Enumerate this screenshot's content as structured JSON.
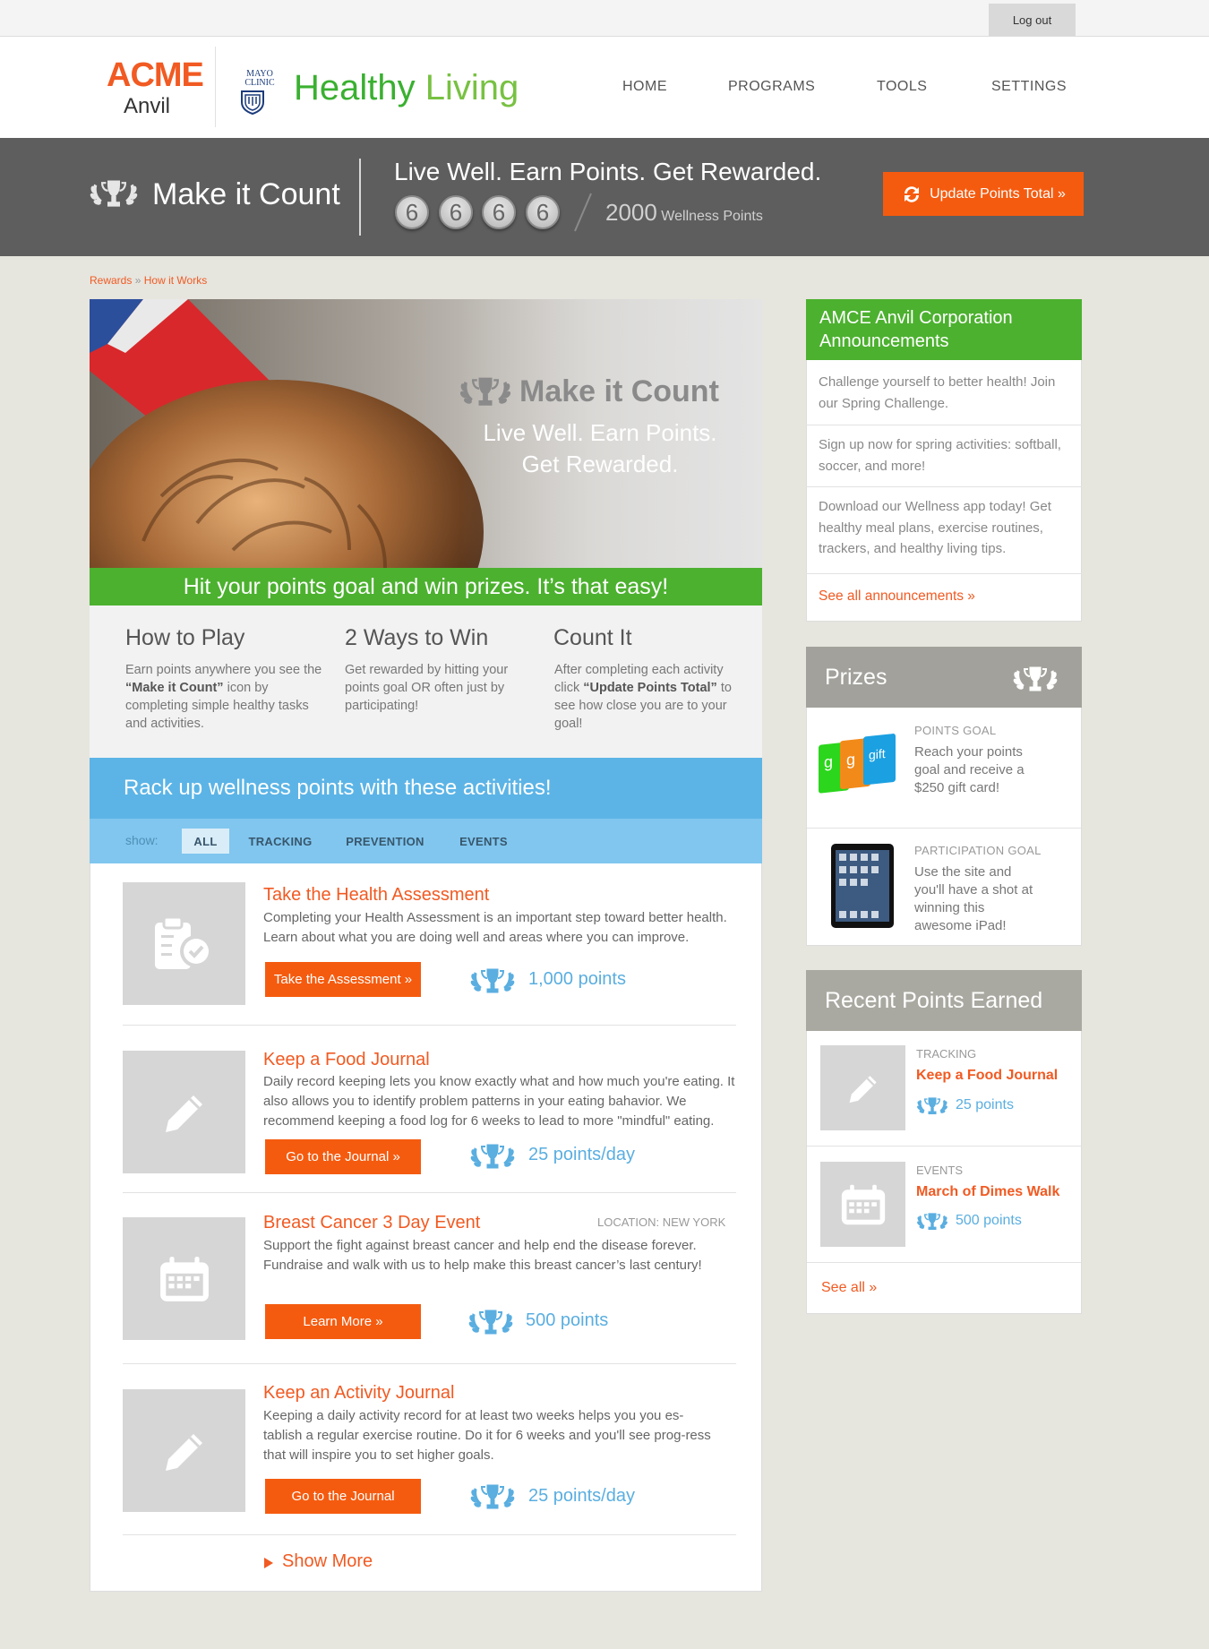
{
  "topbar": {
    "logout_label": "Log out"
  },
  "header": {
    "brand_top": "ACME",
    "brand_bottom": "Anvil",
    "partner_line1": "MAYO",
    "partner_line2": "CLINIC",
    "product_word1": "Healthy",
    "product_word2": "Living",
    "nav": [
      "HOME",
      "PROGRAMS",
      "TOOLS",
      "SETTINGS"
    ]
  },
  "band": {
    "title": "Make it Count",
    "tagline": "Live Well. Earn Points. Get Rewarded.",
    "digits": [
      "6",
      "6",
      "6",
      "6"
    ],
    "goal_value": "2000",
    "goal_label": "Wellness Points",
    "update_button": "Update Points Total »"
  },
  "breadcrumb": {
    "item1": "Rewards",
    "separator": "»",
    "item2": "How it Works"
  },
  "hero": {
    "title": "Make it Count",
    "tagline_line1": "Live Well. Earn Points.",
    "tagline_line2": "Get Rewarded.",
    "green_bar": "Hit your points goal and win prizes. It’s that easy!"
  },
  "howto": [
    {
      "title": "How to Play",
      "text_before": "Earn points anywhere you see the ",
      "bold": "“Make it Count”",
      "text_after": " icon by completing simple healthy tasks and activities."
    },
    {
      "title": "2 Ways to Win",
      "text_before": "Get rewarded by hitting your points goal OR often just by participating!",
      "bold": "",
      "text_after": ""
    },
    {
      "title": "Count It",
      "text_before": "After completing each activity click ",
      "bold": "“Update Points Total”",
      "text_after": " to see how close you are to your goal!"
    }
  ],
  "activities_header": "Rack up wellness points with these activities!",
  "filter": {
    "show_label": "show:",
    "options": [
      "ALL",
      "TRACKING",
      "PREVENTION",
      "EVENTS"
    ],
    "selected": "ALL"
  },
  "activities": [
    {
      "icon": "clipboard-check-icon",
      "title": "Take the Health Assessment",
      "location": "",
      "description": "Completing your Health Assessment is an important step toward better health. Learn about what you are doing well and areas where you can improve.",
      "button": "Take the Assessment »",
      "points": "1,000 points"
    },
    {
      "icon": "pencil-icon",
      "title": "Keep a Food Journal",
      "location": "",
      "description": "Daily record keeping lets you know exactly what and how much you're eating. It also allows you to identify problem patterns in your eating bahavior.  We recommend keeping a food log for 6 weeks to lead to more \"mindful\" eating.",
      "button": "Go to the Journal »",
      "points": "25 points/day"
    },
    {
      "icon": "calendar-icon",
      "title": "Breast Cancer 3 Day Event",
      "location": "LOCATION: NEW YORK",
      "description": "Support the fight against breast cancer and help end the disease forever. Fundraise and walk with us to help make this breast cancer’s last century!",
      "button": "Learn More »",
      "points": "500 points"
    },
    {
      "icon": "pencil-icon",
      "title": "Keep an Activity Journal",
      "location": "",
      "description": "Keeping a daily activity record for at least two weeks helps you you es-tablish a regular exercise routine.  Do it for 6 weeks and you'll see prog-ress that will inspire you to set higher goals.",
      "button": "Go to the Journal",
      "points": "25 points/day"
    }
  ],
  "show_more": "Show More",
  "announcements": {
    "title": "AMCE Anvil Corporation Announcements",
    "items": [
      "Challenge yourself to better health! Join our Spring Challenge.",
      "Sign up now for spring activities: softball, soccer, and more!",
      "Download our Wellness app today! Get healthy meal plans, exercise routines, trackers, and healthy living tips."
    ],
    "link": "See all announcements »"
  },
  "prizes": {
    "title": "Prizes",
    "items": [
      {
        "label": "POINTS GOAL",
        "text": "Reach your points goal and receive a $250 gift card!",
        "card_text": "gift"
      },
      {
        "label": "PARTICIPATION GOAL",
        "text": "Use the site and you'll have a shot at winning this awesome iPad!"
      }
    ]
  },
  "recent": {
    "title": "Recent Points Earned",
    "items": [
      {
        "category": "TRACKING",
        "title": "Keep a Food Journal",
        "points": "25 points"
      },
      {
        "category": "EVENTS",
        "title": "March of Dimes Walk",
        "points": "500 points"
      }
    ],
    "link": "See all »"
  },
  "colors": {
    "accent_orange": "#f55b0f",
    "green": "#4cb12f",
    "blue": "#5cb4e6",
    "band_grey": "#5e5e5e"
  }
}
